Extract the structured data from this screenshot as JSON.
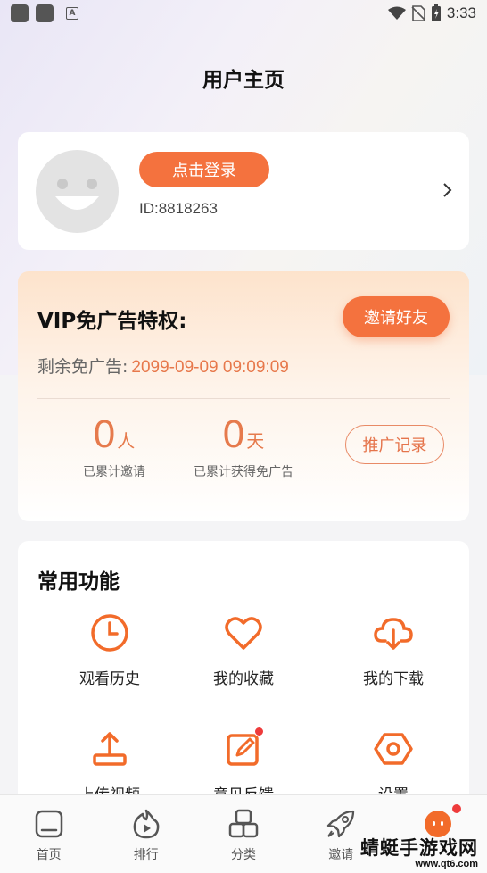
{
  "status_bar": {
    "time": "3:33"
  },
  "header": {
    "title": "用户主页"
  },
  "profile": {
    "login_label": "点击登录",
    "user_id": "ID:8818263"
  },
  "vip": {
    "title": "VIP免广告特权:",
    "invite_label": "邀请好友",
    "remaining_label": "剩余免广告:",
    "remaining_value": "2099-09-09 09:09:09",
    "invited_count": "0",
    "invited_unit": "人",
    "invited_label": "已累计邀请",
    "days_count": "0",
    "days_unit": "天",
    "days_label": "已累计获得免广告",
    "promo_records_label": "推广记录"
  },
  "functions": {
    "title": "常用功能",
    "items": [
      {
        "label": "观看历史",
        "icon": "clock-icon"
      },
      {
        "label": "我的收藏",
        "icon": "heart-icon"
      },
      {
        "label": "我的下载",
        "icon": "cloud-download-icon"
      },
      {
        "label": "上传视频",
        "icon": "upload-icon"
      },
      {
        "label": "意见反馈",
        "icon": "feedback-edit-icon"
      },
      {
        "label": "设置",
        "icon": "settings-icon"
      }
    ]
  },
  "bottom_nav": {
    "items": [
      {
        "label": "首页",
        "icon": "home-icon"
      },
      {
        "label": "排行",
        "icon": "play-fire-icon"
      },
      {
        "label": "分类",
        "icon": "category-icon"
      },
      {
        "label": "邀请",
        "icon": "rocket-icon"
      },
      {
        "label": "",
        "icon": "profile-face-icon"
      }
    ]
  },
  "watermark": {
    "text": "蜻蜓手游戏网",
    "url": "www.qt6.com"
  },
  "colors": {
    "accent": "#f4723e",
    "vip_text": "#e67a4c",
    "badge": "#ee3b3b"
  }
}
